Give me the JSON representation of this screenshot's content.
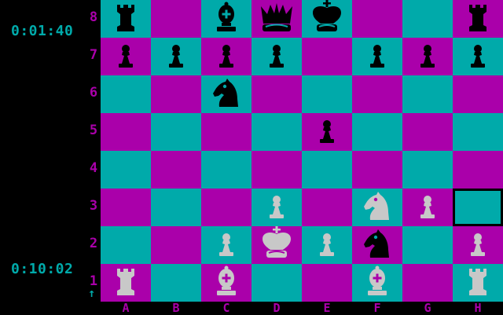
{
  "timers": {
    "top": "0:01:40",
    "bottom": "0:10:02"
  },
  "turn_indicator": "↑",
  "ranks": [
    "8",
    "7",
    "6",
    "5",
    "4",
    "3",
    "2",
    "1"
  ],
  "files": [
    "A",
    "B",
    "C",
    "D",
    "E",
    "F",
    "G",
    "H"
  ],
  "colors": {
    "light_square": "#00aaaa",
    "dark_square": "#aa00aa",
    "black_piece": "#000000",
    "white_piece": "#c8c8c8",
    "label": "#aa00aa",
    "timer": "#00aaaa"
  },
  "board": [
    [
      "br",
      "",
      "bb",
      "bq",
      "bk",
      "",
      "",
      "br"
    ],
    [
      "bp",
      "bp",
      "bp",
      "bp",
      "",
      "bp",
      "bp",
      "bp"
    ],
    [
      "",
      "",
      "bn",
      "",
      "",
      "",
      "",
      ""
    ],
    [
      "",
      "",
      "",
      "",
      "bp",
      "",
      "",
      ""
    ],
    [
      "",
      "",
      "",
      "",
      "",
      "",
      "",
      ""
    ],
    [
      "",
      "",
      "",
      "wp",
      "",
      "wn",
      "wp",
      ""
    ],
    [
      "",
      "",
      "wp",
      "wk",
      "wp",
      "bn",
      "",
      "wp"
    ],
    [
      "wr",
      "",
      "wb",
      "",
      "",
      "wb",
      "",
      "wr"
    ]
  ],
  "cursor": {
    "rank": "3",
    "file": "H"
  }
}
